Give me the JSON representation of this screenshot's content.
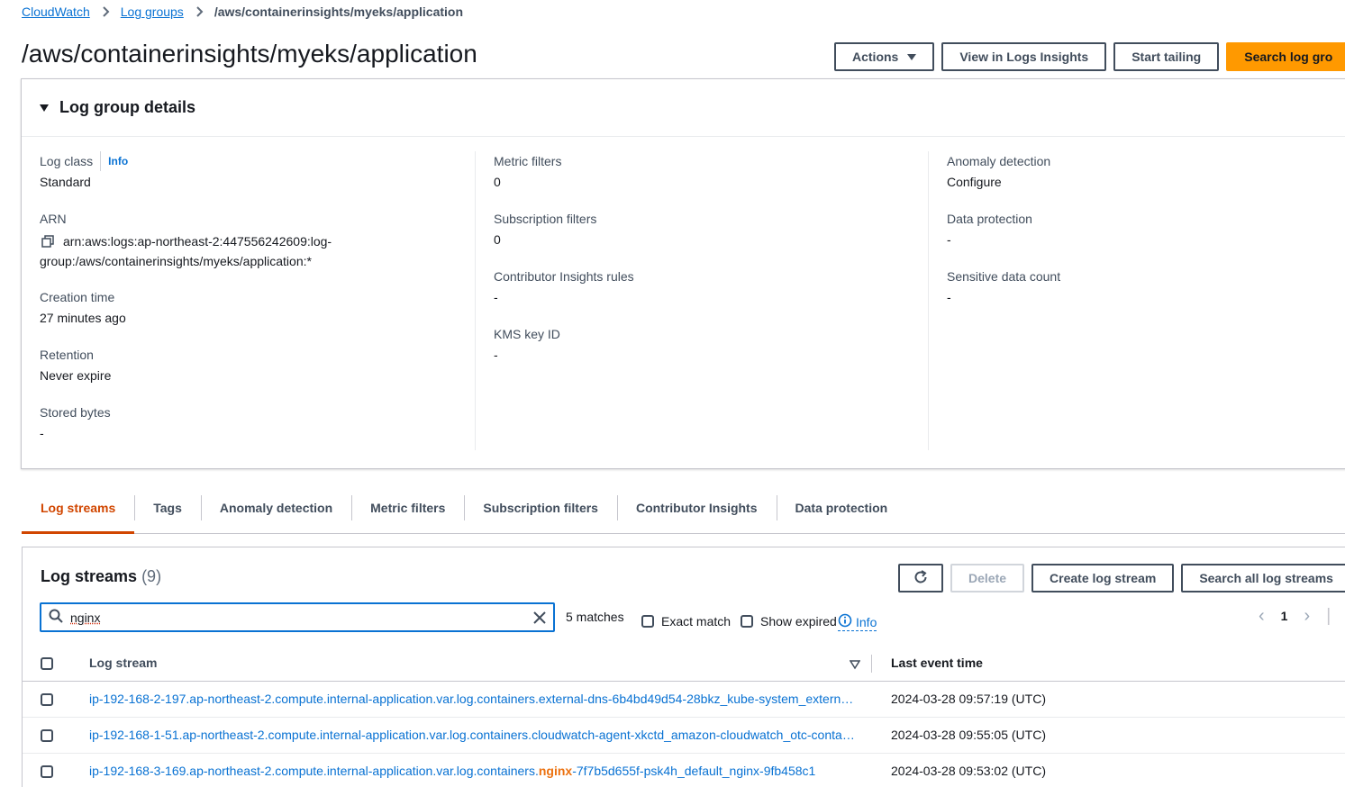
{
  "breadcrumb": {
    "items": [
      "CloudWatch",
      "Log groups"
    ],
    "current": "/aws/containerinsights/myeks/application"
  },
  "header": {
    "title": "/aws/containerinsights/myeks/application",
    "actions_label": "Actions",
    "view_insights_label": "View in Logs Insights",
    "start_tailing_label": "Start tailing",
    "search_log_group_label": "Search log gro"
  },
  "details": {
    "title": "Log group details",
    "info_label": "Info",
    "log_class": {
      "label": "Log class",
      "value": "Standard"
    },
    "arn": {
      "label": "ARN",
      "value_line1": "arn:aws:logs:ap-northeast-2:447556242609:log-",
      "value_line2": "group:/aws/containerinsights/myeks/application:*"
    },
    "creation_time": {
      "label": "Creation time",
      "value": "27 minutes ago"
    },
    "retention": {
      "label": "Retention",
      "value": "Never expire"
    },
    "stored_bytes": {
      "label": "Stored bytes",
      "value": "-"
    },
    "metric_filters": {
      "label": "Metric filters",
      "value": "0"
    },
    "subscription_filters": {
      "label": "Subscription filters",
      "value": "0"
    },
    "contributor_rules": {
      "label": "Contributor Insights rules",
      "value": "-"
    },
    "kms_key": {
      "label": "KMS key ID",
      "value": "-"
    },
    "anomaly_detection": {
      "label": "Anomaly detection",
      "value": "Configure"
    },
    "data_protection": {
      "label": "Data protection",
      "value": "-"
    },
    "sensitive_count": {
      "label": "Sensitive data count",
      "value": "-"
    }
  },
  "tabs": [
    "Log streams",
    "Tags",
    "Anomaly detection",
    "Metric filters",
    "Subscription filters",
    "Contributor Insights",
    "Data protection"
  ],
  "streams": {
    "title": "Log streams",
    "count": "(9)",
    "delete_label": "Delete",
    "create_label": "Create log stream",
    "search_all_label": "Search all log streams",
    "search_value": "nginx",
    "matches": "5 matches",
    "exact_match_label": "Exact match",
    "show_expired_label": "Show expired",
    "info_label": "Info",
    "page": "1",
    "col_stream": "Log stream",
    "col_time": "Last event time",
    "rows": [
      {
        "stream": "ip-192-168-2-197.ap-northeast-2.compute.internal-application.var.log.containers.external-dns-6b4bd49d54-28bkz_kube-system_external-dns",
        "time": "2024-03-28 09:57:19 (UTC)"
      },
      {
        "stream": "ip-192-168-1-51.ap-northeast-2.compute.internal-application.var.log.containers.cloudwatch-agent-xkctd_amazon-cloudwatch_otc-container",
        "time": "2024-03-28 09:55:05 (UTC)"
      },
      {
        "stream": "ip-192-168-3-169.ap-northeast-2.compute.internal-application.var.log.containers.nginx-7f7b5d655f-psk4h_default_nginx-9fb458c1",
        "time": "2024-03-28 09:53:02 (UTC)"
      }
    ]
  },
  "colors": {
    "accent": "#0972d3",
    "primary_button": "#ff9900",
    "active_tab": "#d14600",
    "highlight": "#ec7211"
  }
}
